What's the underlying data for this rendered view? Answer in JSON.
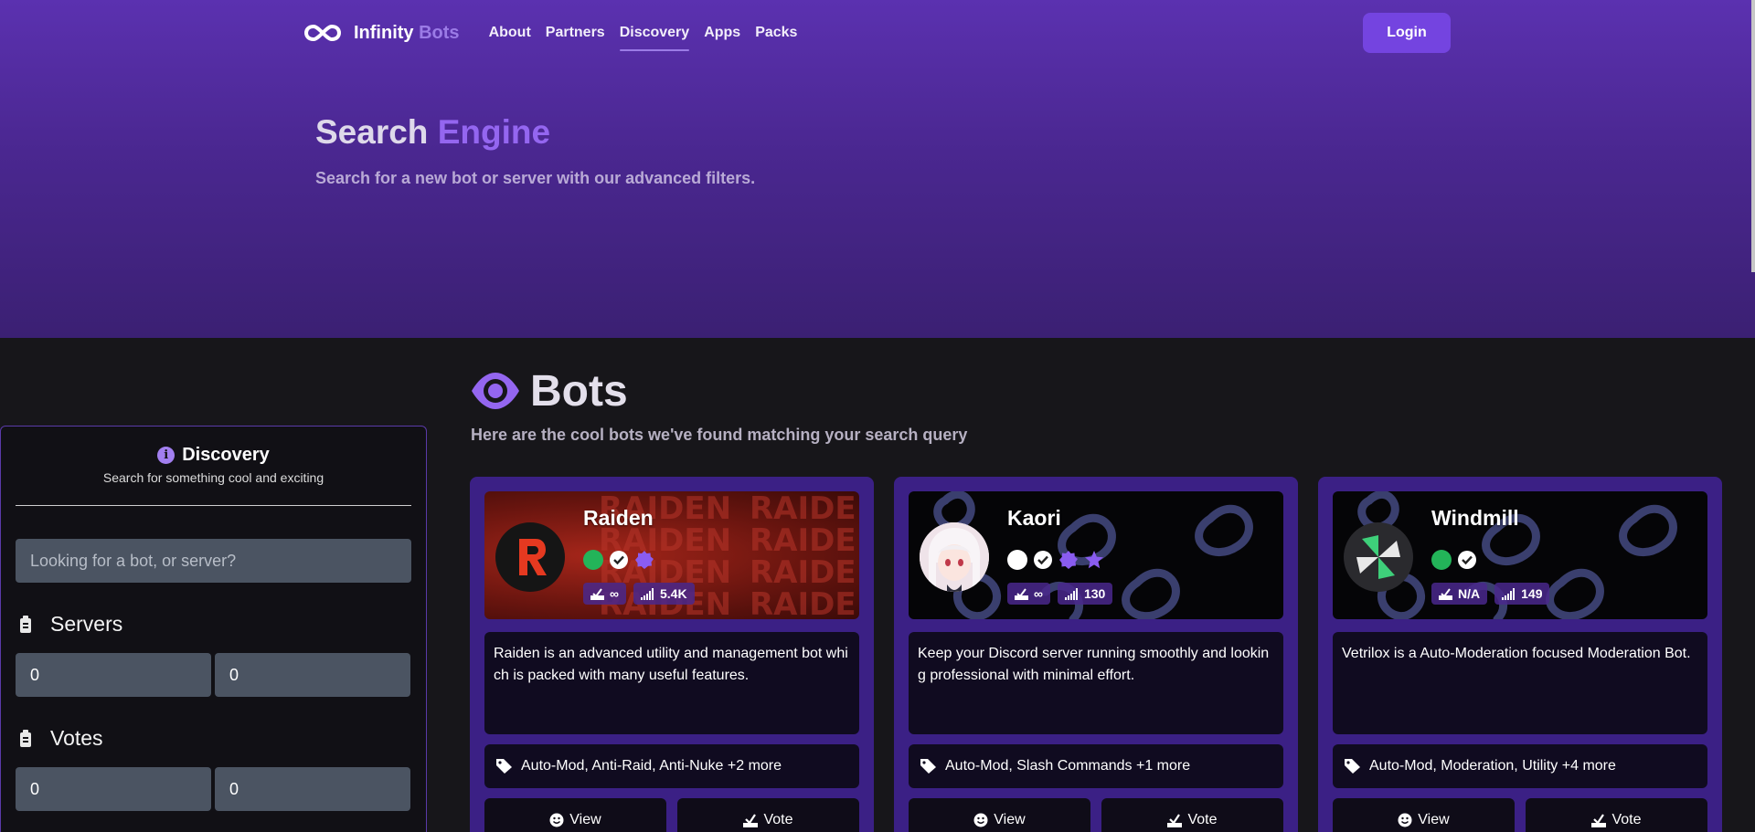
{
  "nav": {
    "brand_main": "Infinity",
    "brand_accent": "Bots",
    "links": [
      "About",
      "Partners",
      "Discovery",
      "Apps",
      "Packs"
    ],
    "active_link": "Discovery",
    "login_label": "Login"
  },
  "hero": {
    "title_main": "Search",
    "title_accent": "Engine",
    "subtitle": "Search for a new bot or server with our advanced filters."
  },
  "sidebar": {
    "title": "Discovery",
    "subtitle": "Search for something cool and exciting",
    "search_placeholder": "Looking for a bot, or server?",
    "servers_label": "Servers",
    "servers_min": "0",
    "servers_max": "0",
    "votes_label": "Votes",
    "votes_min": "0",
    "votes_max": "0"
  },
  "main": {
    "title": "Bots",
    "subtitle": "Here are the cool bots we've found matching your search query"
  },
  "cards": [
    {
      "name": "Raiden",
      "status": "online",
      "votes": "∞",
      "servers": "5.4K",
      "description": "Raiden is an advanced utility and management bot which is packed with many useful features.",
      "tags": "Auto-Mod, Anti-Raid, Anti-Nuke +2 more",
      "view_label": "View",
      "vote_label": "Vote"
    },
    {
      "name": "Kaori",
      "status": "offline",
      "votes": "∞",
      "servers": "130",
      "description": "Keep your Discord server running smoothly and looking professional with minimal effort.",
      "tags": "Auto-Mod, Slash Commands +1 more",
      "view_label": "View",
      "vote_label": "Vote"
    },
    {
      "name": "Windmill",
      "status": "online",
      "votes": "N/A",
      "servers": "149",
      "description": "Vetrilox is a Auto-Moderation focused Moderation Bot.",
      "tags": "Auto-Mod, Moderation, Utility +4 more",
      "view_label": "View",
      "vote_label": "Vote"
    }
  ],
  "icons": {
    "brand": "infinity-icon",
    "info": "info-icon",
    "filter": "filter-icon",
    "eye": "eye-icon",
    "tag": "tag-icon",
    "view": "smile-icon",
    "vote": "vote-box-icon",
    "servers": "signal-bars-icon",
    "verified": "verified-check-icon",
    "certified": "certified-badge-icon",
    "star": "star-icon"
  },
  "colors": {
    "accent": "#9466f0",
    "hero_top": "#5b31b0",
    "card_bg": "#3b2085",
    "online": "#23b459",
    "background": "#17161a"
  }
}
